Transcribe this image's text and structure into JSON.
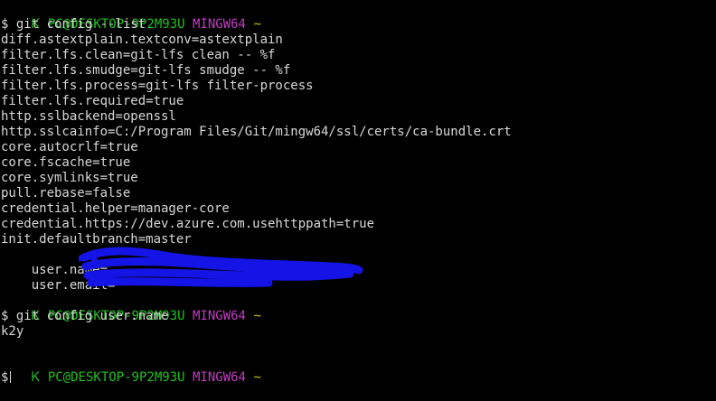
{
  "prompt": {
    "icon": "git-branch-icon",
    "user_host": "PC@DESKTOP-9P2M93U",
    "env": "MINGW64",
    "path": "~",
    "dollar": "$"
  },
  "commands": {
    "first": "git config --list",
    "second": "git config user.name"
  },
  "config_lines": [
    "diff.astextplain.textconv=astextplain",
    "filter.lfs.clean=git-lfs clean -- %f",
    "filter.lfs.smudge=git-lfs smudge -- %f",
    "filter.lfs.process=git-lfs filter-process",
    "filter.lfs.required=true",
    "http.sslbackend=openssl",
    "http.sslcainfo=C:/Program Files/Git/mingw64/ssl/certs/ca-bundle.crt",
    "core.autocrlf=true",
    "core.fscache=true",
    "core.symlinks=true",
    "pull.rebase=false",
    "credential.helper=manager-core",
    "credential.https://dev.azure.com.usehttppath=true",
    "init.defaultbranch=master",
    "user.name=",
    "user.email="
  ],
  "output": {
    "user_name_value": "k2y"
  },
  "colors": {
    "background": "#000000",
    "text": "#d8d8d8",
    "prompt_user": "#1fc21f",
    "prompt_env": "#c33bc3",
    "prompt_path": "#c6c400",
    "redaction": "#1414e6"
  }
}
